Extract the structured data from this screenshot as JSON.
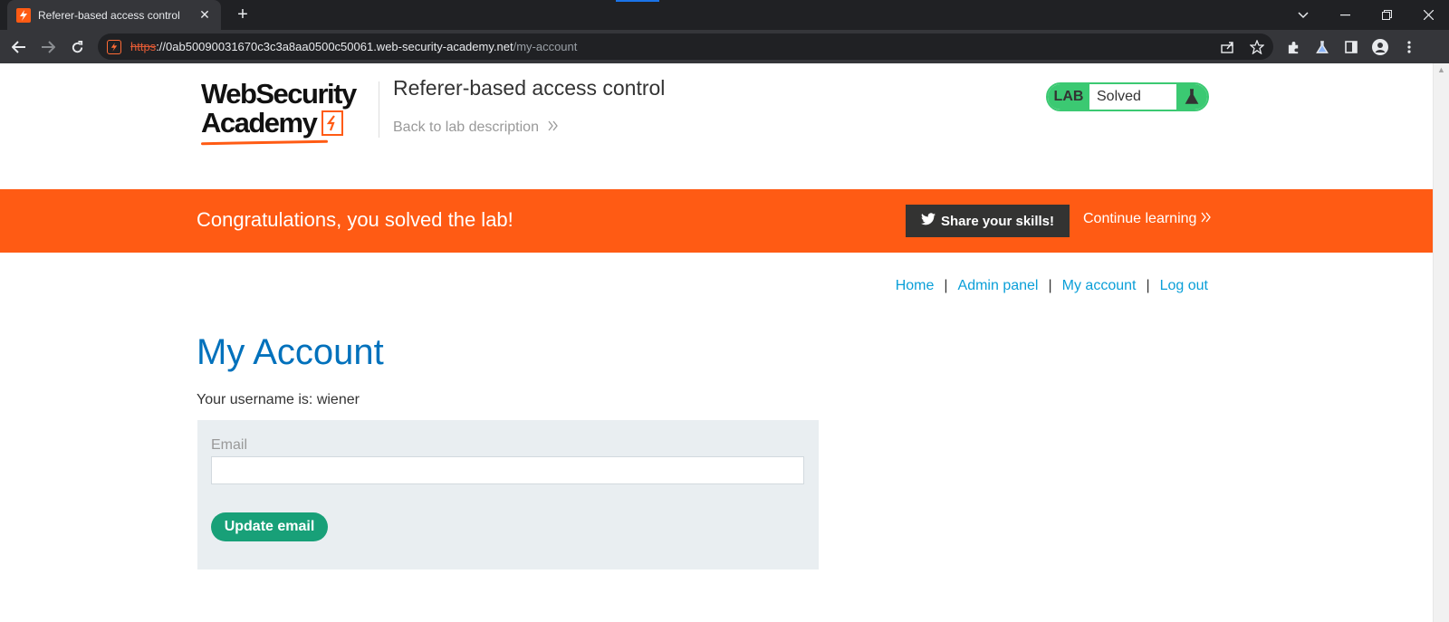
{
  "browser": {
    "tab_title": "Referer-based access control",
    "tab_close": "✕",
    "new_tab": "+",
    "url_scheme": "https",
    "url_host": "://0ab50090031670c3c3a8aa0500c50061.web-security-academy.net",
    "url_path": "/my-account"
  },
  "header": {
    "logo_line1": "WebSecurity",
    "logo_line2": "Academy",
    "lab_title": "Referer-based access control",
    "back_link": "Back to lab description",
    "lab_badge": "LAB",
    "lab_state": "Solved"
  },
  "banner": {
    "message": "Congratulations, you solved the lab!",
    "share_label": "Share your skills!",
    "continue_label": "Continue learning"
  },
  "nav": {
    "home": "Home",
    "admin_panel": "Admin panel",
    "my_account": "My account",
    "log_out": "Log out",
    "separator": "|"
  },
  "main": {
    "heading": "My Account",
    "username_line": "Your username is: wiener",
    "email_label": "Email",
    "email_value": "",
    "update_button": "Update email"
  },
  "colors": {
    "brand_orange": "#ff5b14",
    "lab_green": "#3bc972",
    "link_blue": "#0a9fd8",
    "heading_blue": "#0071bc",
    "button_teal": "#18a078"
  }
}
